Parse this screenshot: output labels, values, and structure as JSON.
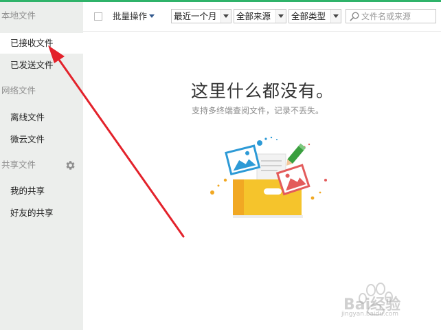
{
  "sidebar": {
    "local_section": "本地文件",
    "local_items": [
      {
        "label": "已接收文件",
        "active": true
      },
      {
        "label": "已发送文件",
        "active": false
      }
    ],
    "network_section": "网络文件",
    "network_items": [
      {
        "label": "离线文件"
      },
      {
        "label": "微云文件"
      }
    ],
    "share_section": "共享文件",
    "share_settings_icon": "gear-icon",
    "share_items": [
      {
        "label": "我的共享"
      },
      {
        "label": "好友的共享"
      }
    ]
  },
  "toolbar": {
    "batch_label": "批量操作",
    "time_filter": "最近一个月",
    "source_filter": "全部来源",
    "type_filter": "全部类型",
    "search_placeholder": "文件名或来源"
  },
  "empty_state": {
    "title": "这里什么都没有。",
    "subtitle": "支持多终端查阅文件，记录不丢失。"
  },
  "watermark": {
    "brand": "Bai经验",
    "url": "jingyan.baidu.com"
  },
  "colors": {
    "accent_green": "#2fb36a",
    "sidebar_bg": "#eceeec",
    "arrow_red": "#e3222b",
    "folder_yellow": "#f5c42c"
  }
}
